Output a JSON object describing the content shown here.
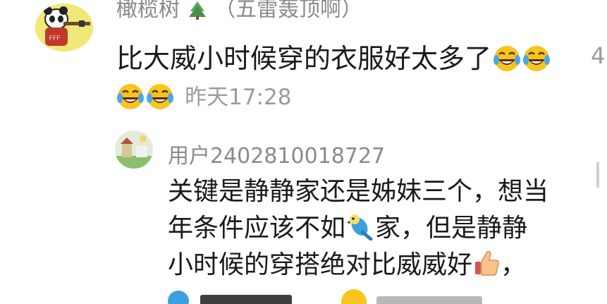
{
  "comment": {
    "username": "橄榄树",
    "username_suffix": "（五雷轰顶啊）",
    "text": "比大威小时候穿的衣服好太多了",
    "emojis": [
      "laugh-cry-icon",
      "laugh-cry-icon",
      "laugh-cry-icon",
      "laugh-cry-icon"
    ],
    "timestamp": "昨天17:28",
    "right_count": "4"
  },
  "reply": {
    "username": "用户2402810018727",
    "lines": [
      "关键是静静家还是姊妹三个，想当",
      "年条件应该不如",
      "家，但是静静",
      "小时候的穿搭绝对比威威好",
      "，"
    ]
  },
  "colors": {
    "username": "#8a8a8a",
    "timestamp": "#9b9b9b",
    "text": "#1a1a1a",
    "emoji_face": "#f7c51e"
  }
}
